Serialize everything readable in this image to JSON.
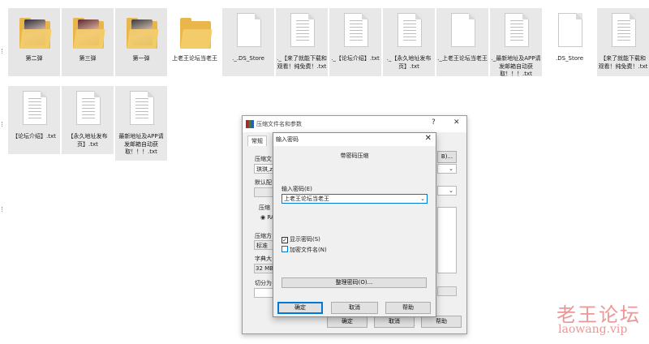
{
  "explorer": {
    "row1": [
      {
        "kind": "photo-folder",
        "label": "第二弹"
      },
      {
        "kind": "photo-folder",
        "label": "第三弹"
      },
      {
        "kind": "photo-folder",
        "label": "第一弹"
      },
      {
        "kind": "folder",
        "label": "上老王论坛当老王"
      },
      {
        "kind": "file",
        "label": "._.DS_Store"
      },
      {
        "kind": "file",
        "label": "._【来了就能下载和观看！纯免费！.txt"
      },
      {
        "kind": "file",
        "label": "._【论坛介绍】.txt"
      },
      {
        "kind": "file",
        "label": "._【永久地址发布页】.txt"
      },
      {
        "kind": "file",
        "label": "._上老王论坛当老王"
      },
      {
        "kind": "file",
        "label": "._最新地址及APP请发邮箱自动获取！！！.txt"
      },
      {
        "kind": "file",
        "label": ".DS_Store"
      },
      {
        "kind": "file",
        "label": "【来了就能下载和观看！纯免费！.txt"
      }
    ],
    "row2": [
      {
        "kind": "file",
        "label": "【论坛介绍】.txt"
      },
      {
        "kind": "file",
        "label": "【永久地址发布页】.txt"
      },
      {
        "kind": "file",
        "label": "最新地址及APP请发邮箱自动获取！！！.txt"
      }
    ]
  },
  "archive_dialog": {
    "title": "压缩文件名和参数",
    "help_glyph": "?",
    "close_glyph": "✕",
    "tab_general": "常规",
    "frag_archive_name": "压缩文",
    "frag_archive_value": "琪琪,z",
    "frag_default": "默认配",
    "frag_compress": "压缩",
    "frag_rar": "RA",
    "frag_method": "压缩方",
    "frag_method_value": "标准",
    "frag_dict": "字典大",
    "frag_dict_value": "32 MB",
    "frag_split": "切分为",
    "browse_suffix": "B)...",
    "ok": "确定",
    "cancel": "取消",
    "help": "帮助"
  },
  "password_dialog": {
    "title": "输入密码",
    "close_glyph": "✕",
    "heading": "带密码压缩",
    "input_label": "输入密码(E)",
    "password_value": "上老王论坛当老王",
    "show_password": "显示密码(S)",
    "show_password_checked": true,
    "encrypt_names": "加密文件名(N)",
    "encrypt_names_checked": false,
    "organize_button": "整理密码(O)...",
    "ok": "确定",
    "cancel": "取消",
    "help": "帮助"
  },
  "watermark": {
    "logo_text": "老王论坛",
    "url": "laowang.vip"
  }
}
